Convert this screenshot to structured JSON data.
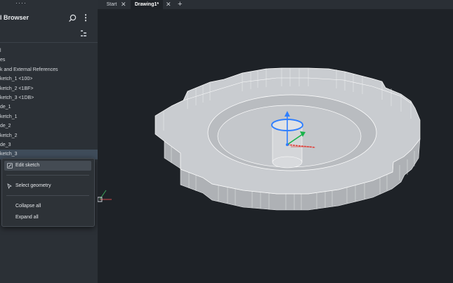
{
  "panel": {
    "grip": "····",
    "title": "l Browser",
    "tree": [
      {
        "label": "l"
      },
      {
        "label": "es"
      },
      {
        "label": "k and External References"
      },
      {
        "label": "ketch_1 <100>"
      },
      {
        "label": "ketch_2 <1BF>"
      },
      {
        "label": "ketch_3 <1DB>"
      },
      {
        "label": "de_1"
      },
      {
        "label": "ketch_1"
      },
      {
        "label": "de_2"
      },
      {
        "label": "ketch_2"
      },
      {
        "label": "de_3"
      },
      {
        "label": "ketch_3"
      }
    ]
  },
  "context_menu": {
    "items": [
      {
        "label": "Edit sketch",
        "icon": "edit-sketch-icon"
      },
      {
        "label": "Select geometry",
        "icon": "select-geometry-icon"
      },
      {
        "label": "Collapse all"
      },
      {
        "label": "Expand all"
      }
    ]
  },
  "tabs": {
    "start": "Start",
    "drawing": "Drawing1*",
    "close": "✕",
    "add": "+"
  },
  "colors": {
    "panel_bg": "#2b3036",
    "viewport_bg": "#1e2227",
    "model_face": "#c8cbcf",
    "model_edge": "#ffffff",
    "gizmo_blue": "#2f7fff",
    "gizmo_green": "#19b34a",
    "gizmo_red": "#e0403a"
  }
}
